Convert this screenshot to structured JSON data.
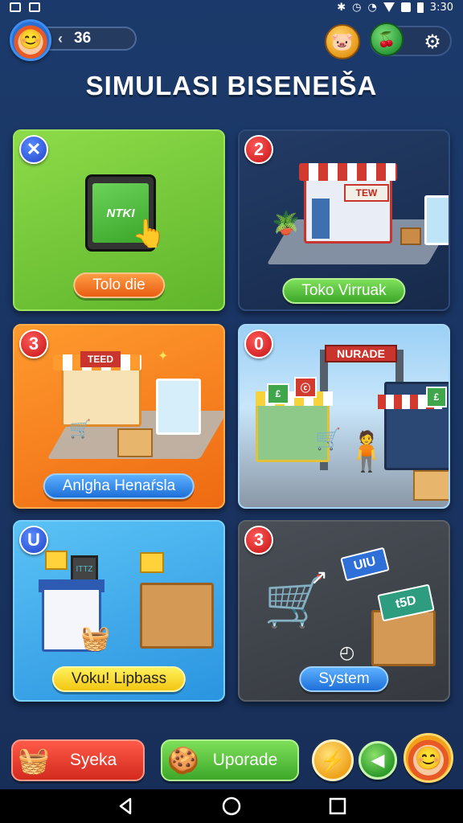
{
  "status_bar": {
    "time": "3:30"
  },
  "player": {
    "level": "36"
  },
  "title": "SIMULASI BISENEIŠA",
  "cards": [
    {
      "badge": "✕",
      "label": "Tolo die",
      "screen_text": "NTKI"
    },
    {
      "badge": "2",
      "label": "Toko Virruak",
      "sign_text": "TEW"
    },
    {
      "badge": "3",
      "label": "Anlgha Henaŕsla",
      "sign_text": "TEED"
    },
    {
      "badge": "0",
      "label": "",
      "gate_text": "NURADE"
    },
    {
      "badge": "U",
      "label": "Voku! Lipbass",
      "screen_text": "ITTZ"
    },
    {
      "badge": "3",
      "label": "System",
      "tag1": "UIU",
      "tag2": "t5D"
    }
  ],
  "bottom_bar": {
    "left_button": "Syeka",
    "middle_button": "Uporade"
  },
  "colors": {
    "background": "#1b3a6b",
    "accent_green": "#5fb52a",
    "accent_orange": "#ee6a12",
    "accent_red": "#d22a1c",
    "accent_blue": "#2a94e0"
  },
  "icons": {
    "status_left": [
      "mail-icon",
      "edit-icon"
    ],
    "top_right": [
      "coin-icon",
      "gem-icon",
      "gear-icon"
    ],
    "bottom_round": [
      "lightning-icon",
      "arrow-left-icon",
      "profile-avatar-icon"
    ],
    "nav": [
      "back-icon",
      "home-icon",
      "recents-icon"
    ]
  }
}
